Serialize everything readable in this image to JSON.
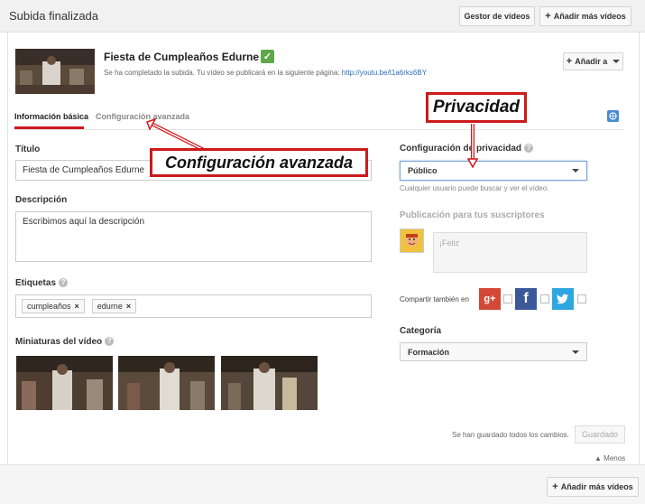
{
  "topbar": {
    "title": "Subida finalizada",
    "manager_button": "Gestor de vídeos",
    "add_more_button": "Añadir más vídeos"
  },
  "video": {
    "title": "Fiesta de Cumpleaños Edurne",
    "message": "Se ha completado la subida. Tu vídeo se publicará en la siguiente página:",
    "link": "http://youtu.be/t1a6rks6BY",
    "add_to_button": "Añadir a"
  },
  "tabs": {
    "basic": "Información básica",
    "advanced": "Configuración avanzada"
  },
  "form": {
    "title_label": "Título",
    "title_value": "Fiesta de Cumpleaños Edurne",
    "description_label": "Descripción",
    "description_value": "Escribimos aquí la descripción",
    "tags_label": "Etiquetas",
    "tags": [
      "cumpleaños",
      "edurne"
    ],
    "thumbnails_label": "Miniaturas del vídeo"
  },
  "privacy": {
    "label": "Configuración de privacidad",
    "value": "Público",
    "hint": "Cualquier usuario puede buscar y ver el vídeo."
  },
  "subscribers": {
    "label": "Publicación para tus suscriptores",
    "placeholder": "¡Feliz"
  },
  "share": {
    "label": "Compartir también en",
    "networks": [
      "google-plus-icon",
      "facebook-icon",
      "twitter-icon"
    ]
  },
  "category": {
    "label": "Categoría",
    "value": "Formación"
  },
  "footer": {
    "saved_message": "Se han guardado todos los cambios.",
    "save_button": "Guardado",
    "less_link": "Menos",
    "add_more_button": "Añadir más vídeos"
  },
  "annotations": {
    "privacy": "Privacidad",
    "advanced": "Configuración avanzada"
  },
  "colors": {
    "accent_red": "#cc181e",
    "link_blue": "#2a6fb8",
    "annotation_red": "#cc1a1a"
  }
}
